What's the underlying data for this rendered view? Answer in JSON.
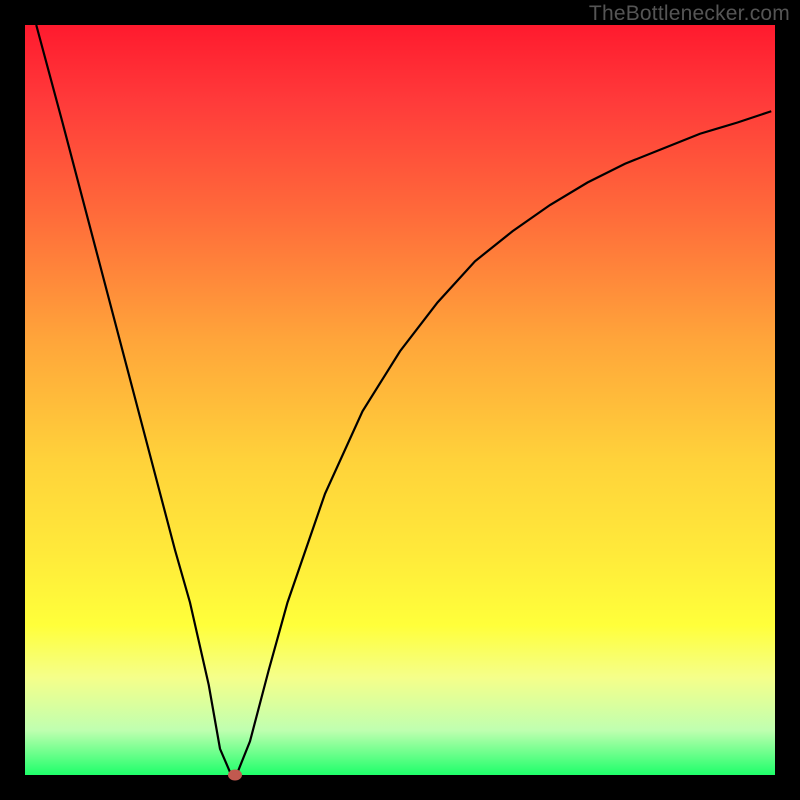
{
  "attribution": "TheBottlenecker.com",
  "chart_data": {
    "type": "line",
    "title": "",
    "xlabel": "",
    "ylabel": "",
    "xlim": [
      0,
      1
    ],
    "ylim": [
      0,
      1
    ],
    "series": [
      {
        "name": "curve",
        "x": [
          0.015,
          0.05,
          0.1,
          0.15,
          0.2,
          0.22,
          0.245,
          0.26,
          0.275,
          0.282,
          0.3,
          0.325,
          0.35,
          0.4,
          0.45,
          0.5,
          0.55,
          0.6,
          0.65,
          0.7,
          0.75,
          0.8,
          0.85,
          0.9,
          0.95,
          0.995
        ],
        "y": [
          1.0,
          0.87,
          0.68,
          0.49,
          0.3,
          0.23,
          0.12,
          0.035,
          0.0,
          0.0,
          0.045,
          0.14,
          0.23,
          0.375,
          0.485,
          0.565,
          0.63,
          0.685,
          0.725,
          0.76,
          0.79,
          0.815,
          0.835,
          0.855,
          0.87,
          0.885
        ]
      }
    ],
    "marker": {
      "x": 0.28,
      "y": 0.0
    },
    "colors": {
      "gradient_top": "#ff1a2e",
      "gradient_bottom": "#1eff6a",
      "curve": "#000000",
      "marker": "#c1594f"
    }
  }
}
